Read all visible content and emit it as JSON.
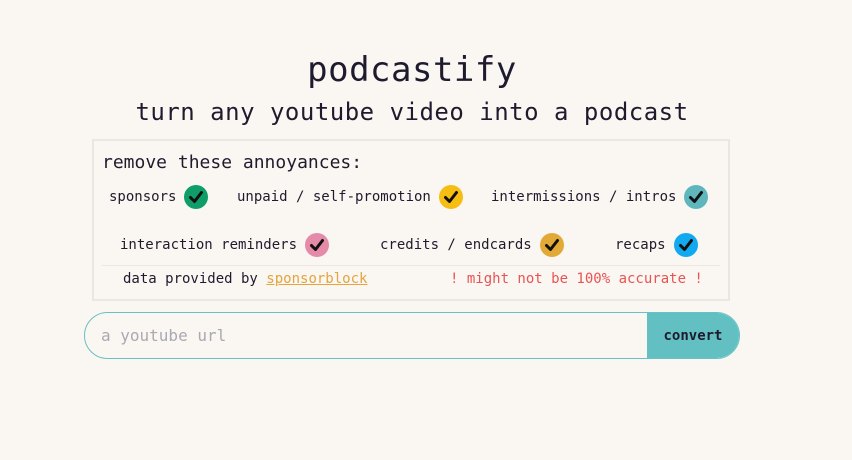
{
  "app": {
    "title": "podcastify",
    "subtitle": "turn any youtube video into a podcast"
  },
  "panel": {
    "heading": "remove these annoyances:",
    "categories": [
      {
        "label": "sponsors",
        "color": "#0f9e6a",
        "checked": true
      },
      {
        "label": "unpaid / self-promotion",
        "color": "#f6bd12",
        "checked": true
      },
      {
        "label": "intermissions / intros",
        "color": "#5fb7bd",
        "checked": true
      },
      {
        "label": "interaction reminders",
        "color": "#e58aa9",
        "checked": true
      },
      {
        "label": "credits / endcards",
        "color": "#e2a937",
        "checked": true
      },
      {
        "label": "recaps",
        "color": "#12a9f0",
        "checked": true
      }
    ],
    "credit_prefix": "data provided by",
    "credit_link": "sponsorblock",
    "warning": "! might not be 100% accurate !"
  },
  "form": {
    "url_placeholder": "a youtube url",
    "url_value": "",
    "convert_label": "convert"
  }
}
